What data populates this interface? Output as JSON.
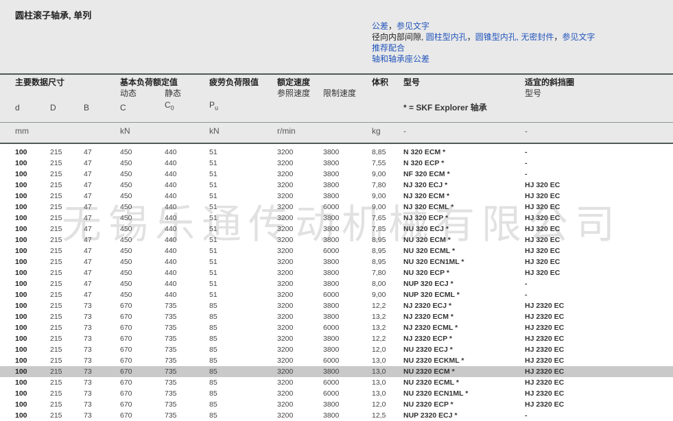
{
  "title": "圆柱滚子轴承, 单列",
  "links": {
    "tolerance": "公差",
    "see_text_1": "参见文字",
    "radial_clearance": "径向内部间隙,",
    "cyl_bore": "圆柱型内孔",
    "taper_bore": "圆锥型内孔, 无密封件",
    "see_text_2": "参见文字",
    "fits": "推荐配合",
    "shaft_housing": "轴和轴承座公差"
  },
  "headers": {
    "main_dims": "主要数据尺寸",
    "load_ratings": "基本负荷额定值",
    "dynamic": "动态",
    "static": "静态",
    "fatigue": "疲劳负荷限值",
    "speed": "额定速度",
    "ref_speed": "参照速度",
    "limit_speed": "限制速度",
    "mass": "体积",
    "designation": "型号",
    "ring": "适宜的斜挡圈",
    "ring_designation": "型号",
    "sym_d": "d",
    "sym_D": "D",
    "sym_B": "B",
    "sym_C": "C",
    "sym_C0": "C",
    "sym_C0_sub": "0",
    "sym_Pu": "P",
    "sym_Pu_sub": "u",
    "skf_note": "* = SKF Explorer 轴承"
  },
  "units": {
    "mm": "mm",
    "kN1": "kN",
    "kN2": "kN",
    "rpm": "r/min",
    "kg": "kg",
    "des": "-",
    "ring": "-"
  },
  "watermark": "无锡乐通传动机械有限公司",
  "rows": [
    [
      "100",
      "215",
      "47",
      "450",
      "440",
      "51",
      "3200",
      "3800",
      "8,85",
      "N 320 ECM *",
      "-"
    ],
    [
      "100",
      "215",
      "47",
      "450",
      "440",
      "51",
      "3200",
      "3800",
      "7,55",
      "N 320 ECP *",
      "-"
    ],
    [
      "100",
      "215",
      "47",
      "450",
      "440",
      "51",
      "3200",
      "3800",
      "9,00",
      "NF 320 ECM *",
      "-"
    ],
    [
      "100",
      "215",
      "47",
      "450",
      "440",
      "51",
      "3200",
      "3800",
      "7,80",
      "NJ 320 ECJ *",
      "HJ 320 EC"
    ],
    [
      "100",
      "215",
      "47",
      "450",
      "440",
      "51",
      "3200",
      "3800",
      "9,00",
      "NJ 320 ECM *",
      "HJ 320 EC"
    ],
    [
      "100",
      "215",
      "47",
      "450",
      "440",
      "51",
      "3200",
      "6000",
      "9,00",
      "NJ 320 ECML *",
      "HJ 320 EC"
    ],
    [
      "100",
      "215",
      "47",
      "450",
      "440",
      "51",
      "3200",
      "3800",
      "7,65",
      "NJ 320 ECP *",
      "HJ 320 EC"
    ],
    [
      "100",
      "215",
      "47",
      "450",
      "440",
      "51",
      "3200",
      "3800",
      "7,85",
      "NU 320 ECJ *",
      "HJ 320 EC"
    ],
    [
      "100",
      "215",
      "47",
      "450",
      "440",
      "51",
      "3200",
      "3800",
      "8,95",
      "NU 320 ECM *",
      "HJ 320 EC"
    ],
    [
      "100",
      "215",
      "47",
      "450",
      "440",
      "51",
      "3200",
      "6000",
      "8,95",
      "NU 320 ECML *",
      "HJ 320 EC"
    ],
    [
      "100",
      "215",
      "47",
      "450",
      "440",
      "51",
      "3200",
      "3800",
      "8,95",
      "NU 320 ECN1ML *",
      "HJ 320 EC"
    ],
    [
      "100",
      "215",
      "47",
      "450",
      "440",
      "51",
      "3200",
      "3800",
      "7,80",
      "NU 320 ECP *",
      "HJ 320 EC"
    ],
    [
      "100",
      "215",
      "47",
      "450",
      "440",
      "51",
      "3200",
      "3800",
      "8,00",
      "NUP 320 ECJ *",
      "-"
    ],
    [
      "100",
      "215",
      "47",
      "450",
      "440",
      "51",
      "3200",
      "6000",
      "9,00",
      "NUP 320 ECML *",
      "-"
    ],
    [
      "100",
      "215",
      "73",
      "670",
      "735",
      "85",
      "3200",
      "3800",
      "12,2",
      "NJ 2320 ECJ *",
      "HJ 2320 EC"
    ],
    [
      "100",
      "215",
      "73",
      "670",
      "735",
      "85",
      "3200",
      "3800",
      "13,2",
      "NJ 2320 ECM *",
      "HJ 2320 EC"
    ],
    [
      "100",
      "215",
      "73",
      "670",
      "735",
      "85",
      "3200",
      "6000",
      "13,2",
      "NJ 2320 ECML *",
      "HJ 2320 EC"
    ],
    [
      "100",
      "215",
      "73",
      "670",
      "735",
      "85",
      "3200",
      "3800",
      "12,2",
      "NJ 2320 ECP *",
      "HJ 2320 EC"
    ],
    [
      "100",
      "215",
      "73",
      "670",
      "735",
      "85",
      "3200",
      "3800",
      "12,0",
      "NU 2320 ECJ *",
      "HJ 2320 EC"
    ],
    [
      "100",
      "215",
      "73",
      "670",
      "735",
      "85",
      "3200",
      "6000",
      "13,0",
      "NU 2320 ECKML *",
      "HJ 2320 EC"
    ],
    [
      "100",
      "215",
      "73",
      "670",
      "735",
      "85",
      "3200",
      "3800",
      "13,0",
      "NU 2320 ECM *",
      "HJ 2320 EC"
    ],
    [
      "100",
      "215",
      "73",
      "670",
      "735",
      "85",
      "3200",
      "6000",
      "13,0",
      "NU 2320 ECML *",
      "HJ 2320 EC"
    ],
    [
      "100",
      "215",
      "73",
      "670",
      "735",
      "85",
      "3200",
      "6000",
      "13,0",
      "NU 2320 ECN1ML *",
      "HJ 2320 EC"
    ],
    [
      "100",
      "215",
      "73",
      "670",
      "735",
      "85",
      "3200",
      "3800",
      "12,0",
      "NU 2320 ECP *",
      "HJ 2320 EC"
    ],
    [
      "100",
      "215",
      "73",
      "670",
      "735",
      "85",
      "3200",
      "3800",
      "12,5",
      "NUP 2320 ECJ *",
      "-"
    ]
  ],
  "highlight_row": 20
}
